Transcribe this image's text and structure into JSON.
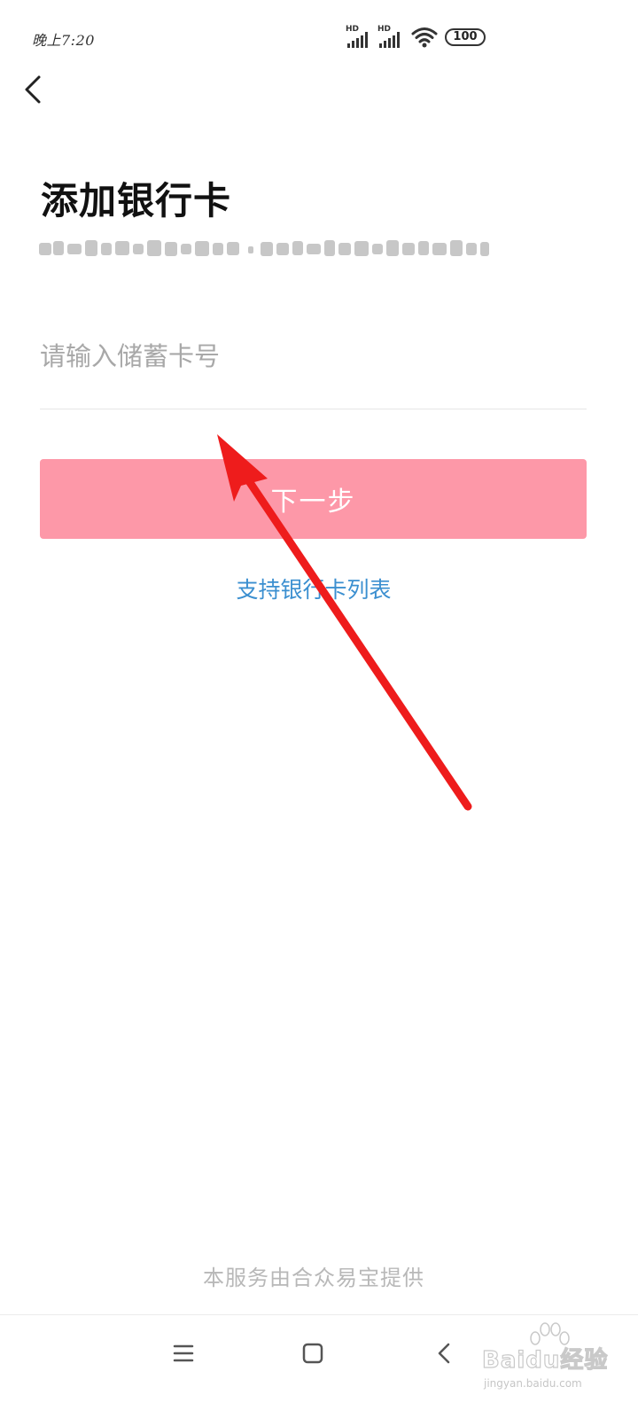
{
  "status_bar": {
    "time": "晚上7:20",
    "battery": "100",
    "hd_label": "HD"
  },
  "header": {
    "back_icon": "chevron-left-icon"
  },
  "page": {
    "title": "添加银行卡"
  },
  "form": {
    "card_input_placeholder": "请输入储蓄卡号",
    "card_input_value": "",
    "next_button_label": "下一步",
    "bank_list_link": "支持银行卡列表"
  },
  "footer": {
    "provider_text": "本服务由合众易宝提供"
  },
  "nav": {
    "menu_icon": "menu-icon",
    "home_icon": "home-icon",
    "back_icon": "back-icon"
  },
  "watermark": {
    "brand": "Baidu经验",
    "url": "jingyan.baidu.com"
  },
  "colors": {
    "button_bg": "#fd98a8",
    "link": "#3b8fd0",
    "annotation_arrow": "#ee1c1c"
  }
}
